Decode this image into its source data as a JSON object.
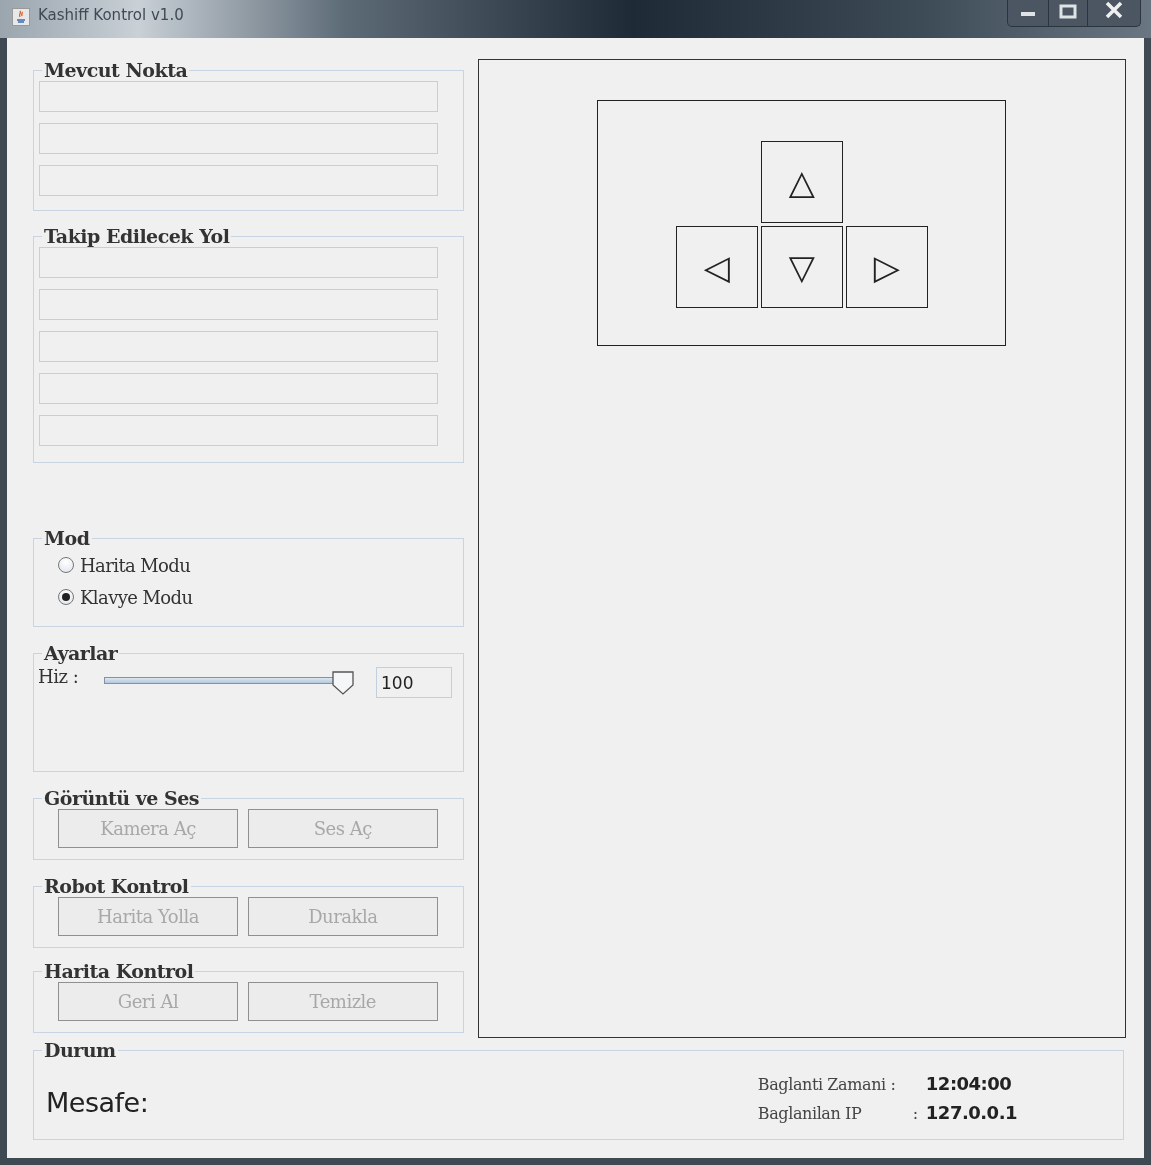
{
  "window": {
    "title": "Kashiff Kontrol v1.0"
  },
  "current_point": {
    "title": "Mevcut Nokta",
    "fields": [
      {
        "kind": "text_field"
      },
      {
        "kind": "text_field"
      },
      {
        "kind": "text_field"
      }
    ]
  },
  "path_to_follow": {
    "title": "Takip Edilecek Yol",
    "fields": [
      {
        "kind": "text_field"
      },
      {
        "kind": "text_field"
      },
      {
        "kind": "text_field"
      },
      {
        "kind": "text_field"
      },
      {
        "kind": "text_field"
      }
    ]
  },
  "mode": {
    "title": "Mod",
    "options": [
      {
        "label": "Harita Modu",
        "selected": false
      },
      {
        "label": "Klavye Modu",
        "selected": true
      }
    ]
  },
  "settings": {
    "title": "Ayarlar",
    "speed_label": "Hiz :",
    "speed": {
      "level": 1.0
    },
    "speed_value": "100"
  },
  "video_audio": {
    "title": "Görüntü ve Ses",
    "buttons": [
      {
        "label": "Kamera Aç",
        "disabled": true
      },
      {
        "label": "Ses Aç",
        "disabled": true
      }
    ]
  },
  "robot_control": {
    "title": "Robot Kontrol",
    "buttons": [
      {
        "label": "Harita Yolla",
        "disabled": true
      },
      {
        "label": "Durakla",
        "disabled": true
      }
    ]
  },
  "map_control": {
    "title": "Harita Kontrol",
    "buttons": [
      {
        "label": "Geri Al",
        "disabled": true
      },
      {
        "label": "Temizle",
        "disabled": true
      }
    ]
  },
  "arrow_keys": [
    {
      "kind": "up",
      "label": "△"
    },
    {
      "kind": "left",
      "label": "◁"
    },
    {
      "kind": "down",
      "label": "▽"
    },
    {
      "kind": "right",
      "label": "▷"
    }
  ],
  "status": {
    "title": "Durum",
    "distance_label": "Mesafe:",
    "connection_time_label": "Baglanti Zamani :",
    "connection_time": "12:04:00",
    "ip_label": "Baglanilan IP",
    "ip_separator": ":",
    "ip": "127.0.0.1"
  }
}
